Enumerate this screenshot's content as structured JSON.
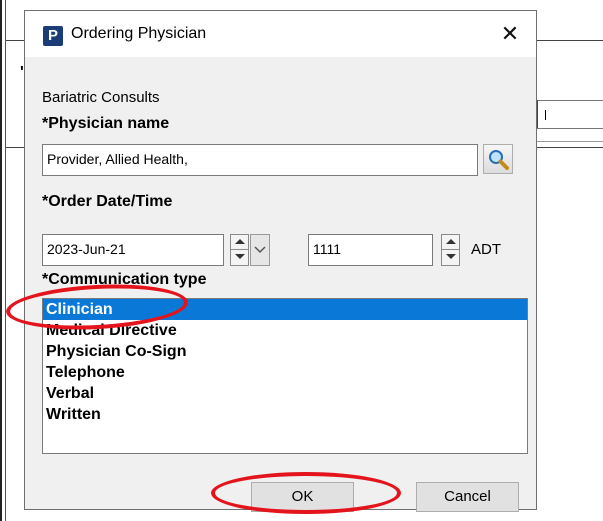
{
  "dialog": {
    "icon_letter": "P",
    "title": "Ordering Physician",
    "close_glyph": "✕",
    "section": "Bariatric Consults",
    "physician_label": "*Physician name",
    "physician_value": "Provider, Allied Health,",
    "date_label": "*Order Date/Time",
    "date_value": "2023-Jun-21",
    "time_value": "1111",
    "timezone": "ADT",
    "comm_label": "*Communication type",
    "comm_options": [
      "Clinician",
      "Medical Directive",
      "Physician Co-Sign",
      "Telephone",
      "Verbal",
      "Written"
    ],
    "selected_option": "Clinician",
    "ok_label": "OK",
    "cancel_label": "Cancel"
  },
  "background": {
    "quote_glyph": "'"
  },
  "colors": {
    "selection": "#0a78d7",
    "annotation": "#e3141c",
    "icon_bg": "#1a3d75"
  },
  "icons": {
    "app": "app-p-icon",
    "close": "close-icon",
    "search": "magnifier-icon",
    "spin": "spinner-icon",
    "dropdown": "chevron-down-icon"
  }
}
